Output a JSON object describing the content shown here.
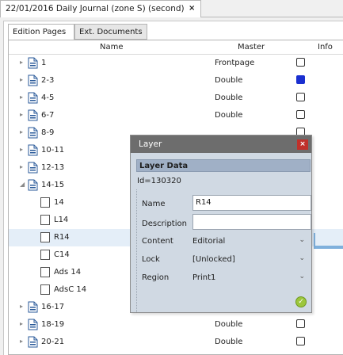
{
  "document_tab": {
    "title": "22/01/2016 Daily Journal (zone S) (second)",
    "close": "×"
  },
  "subtabs": [
    "Edition Pages",
    "Ext. Documents"
  ],
  "columns": {
    "name": "Name",
    "master": "Master",
    "info": "Info"
  },
  "rows": [
    {
      "name": "1",
      "master": "Frontpage",
      "checked": false
    },
    {
      "name": "2-3",
      "master": "Double",
      "checked": true
    },
    {
      "name": "4-5",
      "master": "Double",
      "checked": false
    },
    {
      "name": "6-7",
      "master": "Double",
      "checked": false
    },
    {
      "name": "8-9",
      "master": "",
      "checked": false
    },
    {
      "name": "10-11",
      "master": "",
      "checked": false
    },
    {
      "name": "12-13",
      "master": "",
      "checked": false
    },
    {
      "name": "14-15",
      "master": "",
      "checked": false
    },
    {
      "name": "14",
      "master": "",
      "checked": false
    },
    {
      "name": "L14",
      "master": "",
      "checked": false
    },
    {
      "name": "R14",
      "master": "",
      "checked": false
    },
    {
      "name": "C14",
      "master": "",
      "checked": false
    },
    {
      "name": "Ads 14",
      "master": "",
      "checked": false
    },
    {
      "name": "AdsC 14",
      "master": "",
      "checked": false
    },
    {
      "name": "16-17",
      "master": "Double",
      "checked": false
    },
    {
      "name": "18-19",
      "master": "Double",
      "checked": false
    },
    {
      "name": "20-21",
      "master": "Double",
      "checked": false
    }
  ],
  "dialog": {
    "title": "Layer",
    "close": "×",
    "section": "Layer Data",
    "id_text": "Id=130320",
    "name_label": "Name",
    "name_value": "R14",
    "description_label": "Description",
    "description_value": "",
    "content_label": "Content",
    "content_value": "Editorial",
    "lock_label": "Lock",
    "lock_value": "[Unlocked]",
    "region_label": "Region",
    "region_value": "Print1",
    "ok": "✓"
  },
  "colors": {
    "selected_row": "#e4eef8",
    "checkbox_on": "#1a2fd0",
    "dialog_title": "#6d6d6d",
    "dialog_bg": "#d0d9e3",
    "ok_button": "#9cc63c",
    "close_button": "#c0302a"
  }
}
